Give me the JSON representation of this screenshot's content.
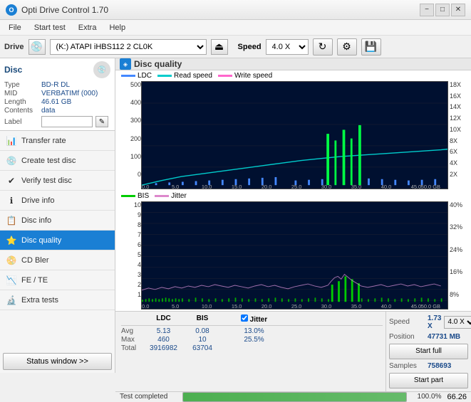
{
  "app": {
    "title": "Opti Drive Control 1.70",
    "icon": "O"
  },
  "titlebar": {
    "minimize": "−",
    "maximize": "□",
    "close": "✕"
  },
  "menu": {
    "items": [
      "File",
      "Start test",
      "Extra",
      "Help"
    ]
  },
  "drivebar": {
    "drive_label": "Drive",
    "drive_value": "(K:) ATAPI iHBS112  2 CL0K",
    "speed_label": "Speed",
    "speed_value": "4.0 X"
  },
  "disc": {
    "title": "Disc",
    "type_label": "Type",
    "type_value": "BD-R DL",
    "mid_label": "MID",
    "mid_value": "VERBATIMf (000)",
    "length_label": "Length",
    "length_value": "46.61 GB",
    "contents_label": "Contents",
    "contents_value": "data",
    "label_label": "Label",
    "label_value": ""
  },
  "nav": {
    "items": [
      {
        "id": "transfer-rate",
        "label": "Transfer rate",
        "icon": "📊",
        "active": false
      },
      {
        "id": "create-test-disc",
        "label": "Create test disc",
        "icon": "💿",
        "active": false
      },
      {
        "id": "verify-test-disc",
        "label": "Verify test disc",
        "icon": "✔",
        "active": false
      },
      {
        "id": "drive-info",
        "label": "Drive info",
        "icon": "ℹ",
        "active": false
      },
      {
        "id": "disc-info",
        "label": "Disc info",
        "icon": "📋",
        "active": false
      },
      {
        "id": "disc-quality",
        "label": "Disc quality",
        "icon": "⭐",
        "active": true
      },
      {
        "id": "cd-bler",
        "label": "CD Bler",
        "icon": "📀",
        "active": false
      },
      {
        "id": "fe-te",
        "label": "FE / TE",
        "icon": "📉",
        "active": false
      },
      {
        "id": "extra-tests",
        "label": "Extra tests",
        "icon": "🔬",
        "active": false
      }
    ],
    "status_window": "Status window >>"
  },
  "chart": {
    "title": "Disc quality",
    "legend_top": [
      {
        "label": "LDC",
        "color": "#4488ff"
      },
      {
        "label": "Read speed",
        "color": "#00cccc"
      },
      {
        "label": "Write speed",
        "color": "#ff66cc"
      }
    ],
    "legend_bottom": [
      {
        "label": "BIS",
        "color": "#00cc00"
      },
      {
        "label": "Jitter",
        "color": "#ff66cc"
      }
    ],
    "top": {
      "ymax": 500,
      "y_labels_left": [
        "500",
        "400",
        "300",
        "200",
        "100",
        "0"
      ],
      "y_labels_right": [
        "18X",
        "16X",
        "14X",
        "12X",
        "10X",
        "8X",
        "6X",
        "4X",
        "2X"
      ],
      "x_labels": [
        "0.0",
        "5.0",
        "10.0",
        "15.0",
        "20.0",
        "25.0",
        "30.0",
        "35.0",
        "40.0",
        "45.0",
        "50.0 GB"
      ]
    },
    "bottom": {
      "y_labels_left": [
        "10",
        "9",
        "8",
        "7",
        "6",
        "5",
        "4",
        "3",
        "2",
        "1"
      ],
      "y_labels_right": [
        "40%",
        "32%",
        "24%",
        "16%",
        "8%"
      ],
      "x_labels": [
        "0.0",
        "5.0",
        "10.0",
        "15.0",
        "20.0",
        "25.0",
        "30.0",
        "35.0",
        "40.0",
        "45.0",
        "50.0 GB"
      ]
    }
  },
  "stats": {
    "headers": [
      "",
      "LDC",
      "BIS",
      "",
      "Jitter",
      "Speed",
      ""
    ],
    "avg_label": "Avg",
    "avg_ldc": "5.13",
    "avg_bis": "0.08",
    "avg_jitter": "13.0%",
    "max_label": "Max",
    "max_ldc": "460",
    "max_bis": "10",
    "max_jitter": "25.5%",
    "total_label": "Total",
    "total_ldc": "3916982",
    "total_bis": "63704",
    "speed_label": "Speed",
    "speed_value": "1.73 X",
    "speed_select": "4.0 X",
    "position_label": "Position",
    "position_value": "47731 MB",
    "samples_label": "Samples",
    "samples_value": "758693",
    "jitter_checked": true,
    "jitter_label": "Jitter",
    "start_full": "Start full",
    "start_part": "Start part"
  },
  "statusbar": {
    "text": "Test completed",
    "progress": 100.0,
    "progress_text": "100.0%",
    "right_value": "66.26"
  },
  "colors": {
    "accent": "#1a7fd4",
    "active_nav": "#1a7fd4",
    "data_blue": "#1a4a8a",
    "ldc_color": "#4488ff",
    "read_speed_color": "#00cccc",
    "write_speed_color": "#ff66cc",
    "bis_color": "#00cc00",
    "jitter_color": "#dd88cc",
    "chart_bg": "#001030"
  }
}
